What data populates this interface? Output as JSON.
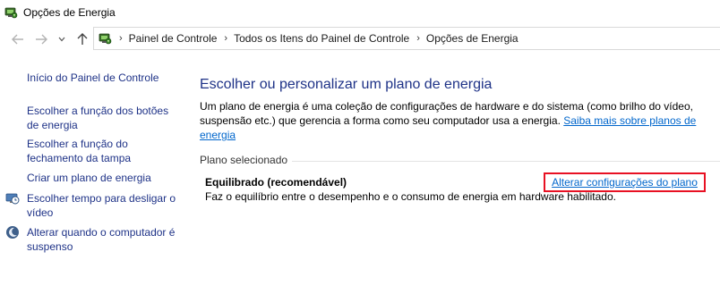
{
  "window": {
    "title": "Opções de Energia",
    "icon": "power-options-icon"
  },
  "nav": {
    "back_icon": "arrow-left-icon",
    "forward_icon": "arrow-right-icon",
    "recent_icon": "chevron-down-icon",
    "up_icon": "arrow-up-icon"
  },
  "breadcrumb": {
    "icon": "power-options-icon",
    "separator": "›",
    "items": [
      {
        "label": "Painel de Controle"
      },
      {
        "label": "Todos os Itens do Painel de Controle"
      },
      {
        "label": "Opções de Energia"
      }
    ]
  },
  "sidebar": {
    "items": [
      {
        "label": "Início do Painel de Controle"
      },
      {
        "label": "Escolher a função dos botões de energia"
      },
      {
        "label": "Escolher a função do fechamento da tampa"
      },
      {
        "label": "Criar um plano de energia"
      },
      {
        "label": "Escolher tempo para desligar o vídeo",
        "icon": "display-clock-icon"
      },
      {
        "label": "Alterar quando o computador é suspenso",
        "icon": "moon-icon"
      }
    ]
  },
  "main": {
    "heading": "Escolher ou personalizar um plano de energia",
    "description": "Um plano de energia é uma coleção de configurações de hardware e do sistema (como brilho do vídeo, suspensão etc.) que gerencia a forma como seu computador usa a energia.",
    "learn_more_link": "Saiba mais sobre planos de energia",
    "section_label": "Plano selecionado",
    "plan": {
      "name": "Equilibrado (recomendável)",
      "description": "Faz o equilíbrio entre o desempenho e o consumo de energia em hardware habilitado.",
      "change_link": "Alterar configurações do plano"
    }
  },
  "colors": {
    "nav_link": "#1e3287",
    "hyperlink": "#0066cc",
    "highlight_border": "#e81123"
  }
}
